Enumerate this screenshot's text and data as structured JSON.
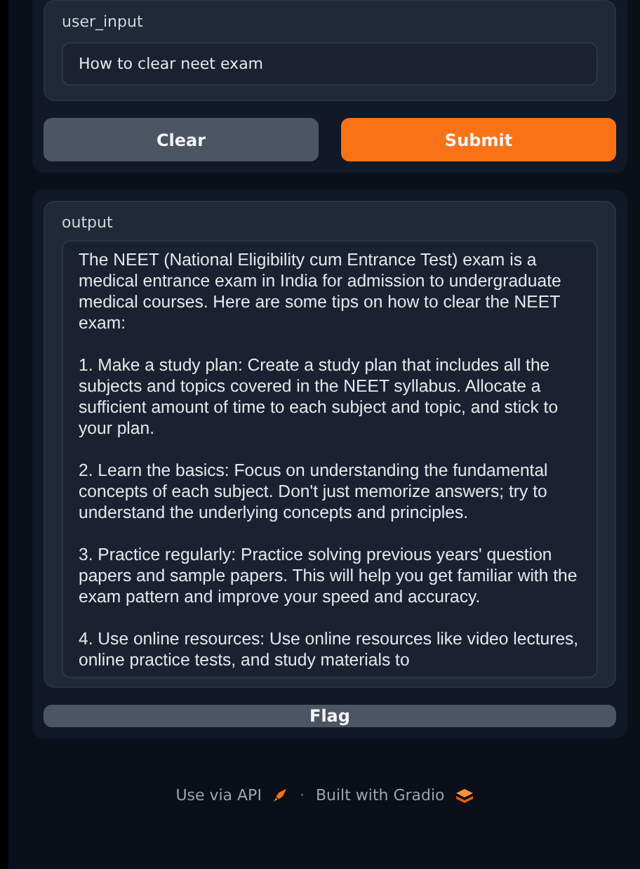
{
  "input": {
    "label": "user_input",
    "value": "How to clear neet exam"
  },
  "buttons": [
    {
      "label": "Clear",
      "kind": "secondary"
    },
    {
      "label": "Submit",
      "kind": "primary"
    }
  ],
  "output": {
    "label": "output",
    "text": "The NEET (National Eligibility cum Entrance Test) exam is a medical entrance exam in India for admission to undergraduate medical courses. Here are some tips on how to clear the NEET exam:\n\n1. Make a study plan: Create a study plan that includes all the subjects and topics covered in the NEET syllabus. Allocate a sufficient amount of time to each subject and topic, and stick to your plan.\n\n2. Learn the basics: Focus on understanding the fundamental concepts of each subject. Don't just memorize answers; try to understand the underlying concepts and principles.\n\n3. Practice regularly: Practice solving previous years' question papers and sample papers. This will help you get familiar with the exam pattern and improve your speed and accuracy.\n\n4. Use online resources: Use online resources like video lectures, online practice tests, and study materials to"
  },
  "flag": {
    "label": "Flag"
  },
  "footer": {
    "api": "Use via API",
    "separator": "·",
    "built": "Built with Gradio"
  }
}
